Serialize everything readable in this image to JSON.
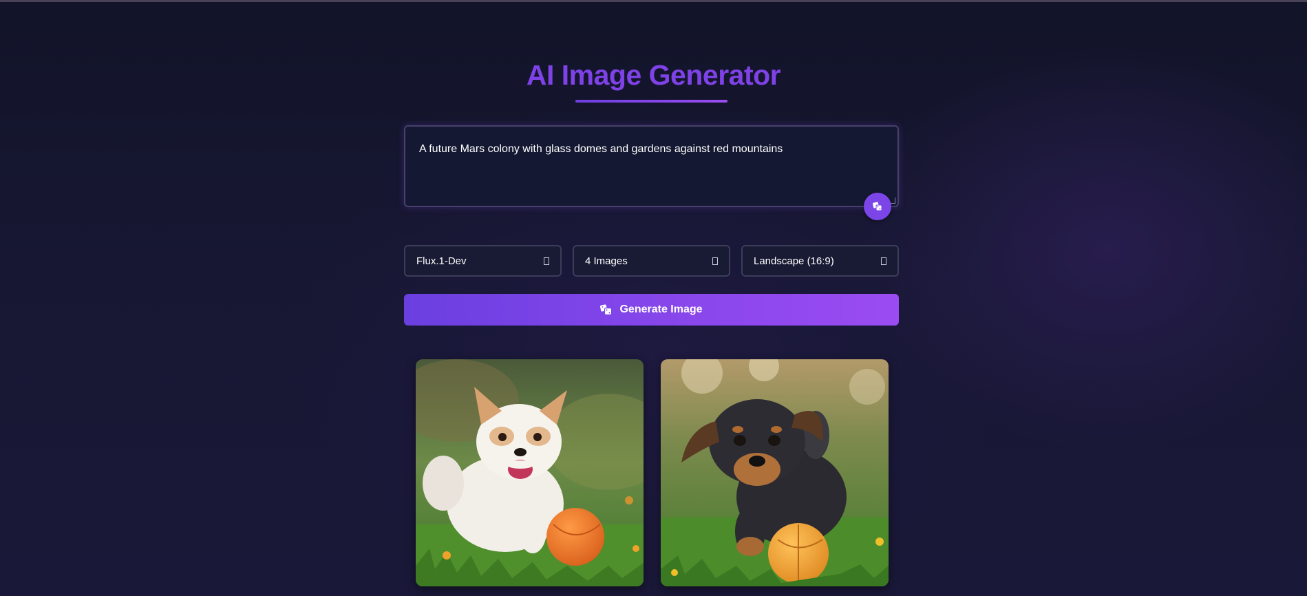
{
  "header": {
    "title": "AI Image Generator"
  },
  "prompt": {
    "value": "A future Mars colony with glass domes and gardens against red mountains",
    "random_button_icon": "dice-icon"
  },
  "options": {
    "model": {
      "selected": "Flux.1-Dev"
    },
    "count": {
      "selected": "4 Images"
    },
    "aspect": {
      "selected": "Landscape (16:9)"
    }
  },
  "generate": {
    "label": "Generate Image",
    "icon": "dice-icon"
  },
  "gallery": {
    "images": [
      {
        "description_icon": "image-white-puppy"
      },
      {
        "description_icon": "image-black-puppy"
      }
    ]
  },
  "colors": {
    "accent": "#7e42e6",
    "button_gradient_start": "#6a3fe0",
    "button_gradient_end": "#9a4cf2",
    "background": "#161733"
  }
}
